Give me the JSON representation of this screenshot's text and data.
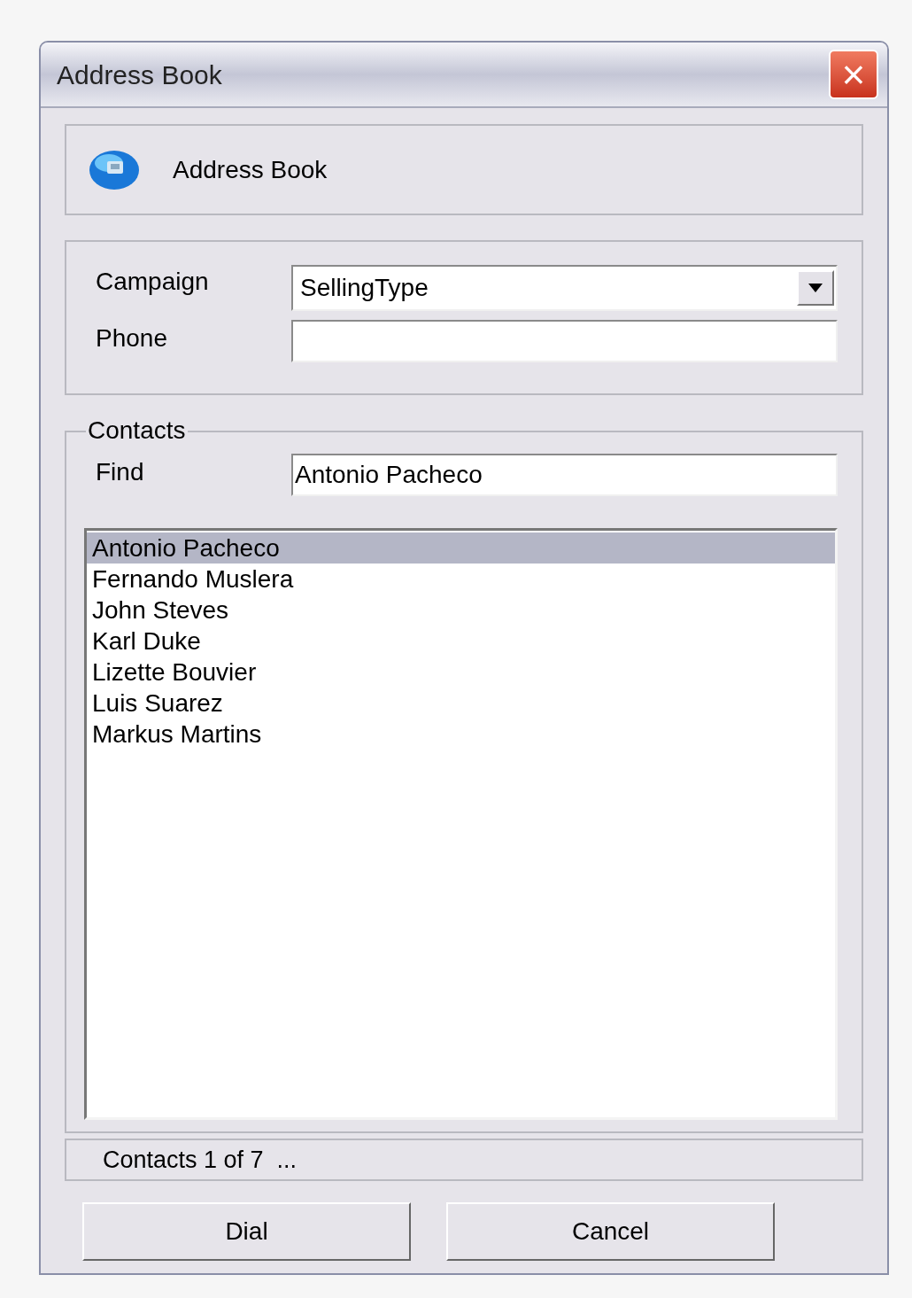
{
  "window": {
    "title": "Address Book",
    "close": "×"
  },
  "header": {
    "title": "Address Book"
  },
  "campaign": {
    "label": "Campaign",
    "value": "SellingType"
  },
  "phone": {
    "label": "Phone"
  },
  "contacts": {
    "legend": "Contacts",
    "find_label": "Find",
    "find_value": "Antonio Pacheco",
    "items": [
      {
        "name": "Antonio Pacheco",
        "selected": true
      },
      {
        "name": "Fernando Muslera",
        "selected": false
      },
      {
        "name": "John Steves",
        "selected": false
      },
      {
        "name": "Karl Duke",
        "selected": false
      },
      {
        "name": "Lizette Bouvier",
        "selected": false
      },
      {
        "name": "Luis Suarez",
        "selected": false
      },
      {
        "name": "Markus Martins",
        "selected": false
      }
    ]
  },
  "status_bar": "Contacts 1 of 7  ...",
  "buttons": [
    "Dial",
    "Cancel"
  ]
}
